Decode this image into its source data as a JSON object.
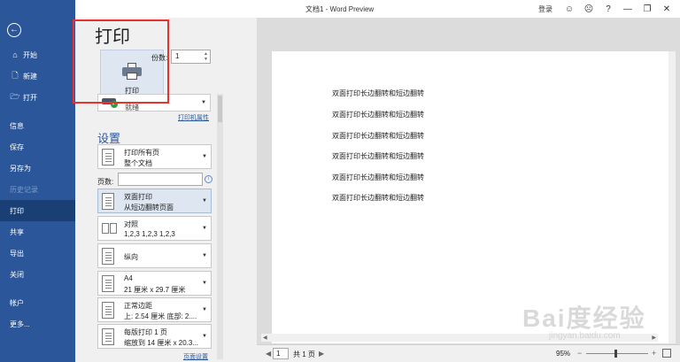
{
  "window": {
    "title": "文档1 - Word Preview",
    "login": "登录",
    "buttons": {
      "smile": "☺",
      "frown": "☹",
      "help": "?",
      "minimize": "—",
      "restore": "❐",
      "close": "✕"
    }
  },
  "sidebar": {
    "back_icon": "←",
    "items": [
      {
        "label": "开始",
        "icon": "⌂"
      },
      {
        "label": "新建",
        "icon": "🗋"
      },
      {
        "label": "打开",
        "icon": "🗁"
      },
      {
        "label": "信息"
      },
      {
        "label": "保存"
      },
      {
        "label": "另存为"
      },
      {
        "label": "历史记录"
      },
      {
        "label": "打印"
      },
      {
        "label": "共享"
      },
      {
        "label": "导出"
      },
      {
        "label": "关闭"
      },
      {
        "label": "帐户"
      },
      {
        "label": "更多..."
      }
    ]
  },
  "print": {
    "title": "打印",
    "print_button": "打印",
    "copies_label": "份数:",
    "copies_value": "1",
    "printer_name": "就绪",
    "printer_properties": "打印机属性",
    "settings_title": "设置",
    "pages_label": "页数:",
    "pages_value": "",
    "page_setup": "页面设置",
    "options": [
      {
        "line1": "打印所有页",
        "line2": "整个文档"
      },
      {
        "line1": "双面打印",
        "line2": "从短边翻转页面"
      },
      {
        "line1": "对照",
        "line2": "1,2,3     1,2,3     1,2,3"
      },
      {
        "line1": "纵向",
        "line2": ""
      },
      {
        "line1": "A4",
        "line2": "21 厘米 x 29.7 厘米"
      },
      {
        "line1": "正常边距",
        "line2": "上: 2.54 厘米 底部: 2...."
      },
      {
        "line1": "每版打印 1 页",
        "line2": "缩放到 14 厘米 x 20.3..."
      }
    ]
  },
  "preview": {
    "lines": [
      "双面打印长边翻转和短边翻转",
      "双面打印长边翻转和短边翻转",
      "双面打印长边翻转和短边翻转",
      "双面打印长边翻转和短边翻转",
      "双面打印长边翻转和短边翻转",
      "双面打印长边翻转和短边翻转"
    ]
  },
  "status": {
    "prev": "◀",
    "page": "1",
    "total": "共 1 页",
    "next": "▶",
    "zoom": "95%"
  },
  "watermark": {
    "big": "Bai度经验",
    "small": "jingyan.baidu.com"
  }
}
